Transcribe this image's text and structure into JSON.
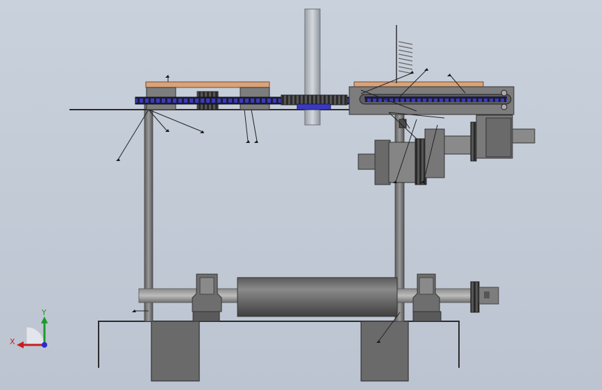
{
  "triad": {
    "x_label": "X",
    "y_label": "Y",
    "x_color": "#c81e1e",
    "y_color": "#1e9a2a",
    "z_color": "#2a2ad0"
  },
  "colors": {
    "metal": "#7a7a7a",
    "metal_dark": "#4f4f4f",
    "wood": "#d9a37a",
    "chain": "#3a3ac0",
    "base_block": "#6a6a6a"
  }
}
